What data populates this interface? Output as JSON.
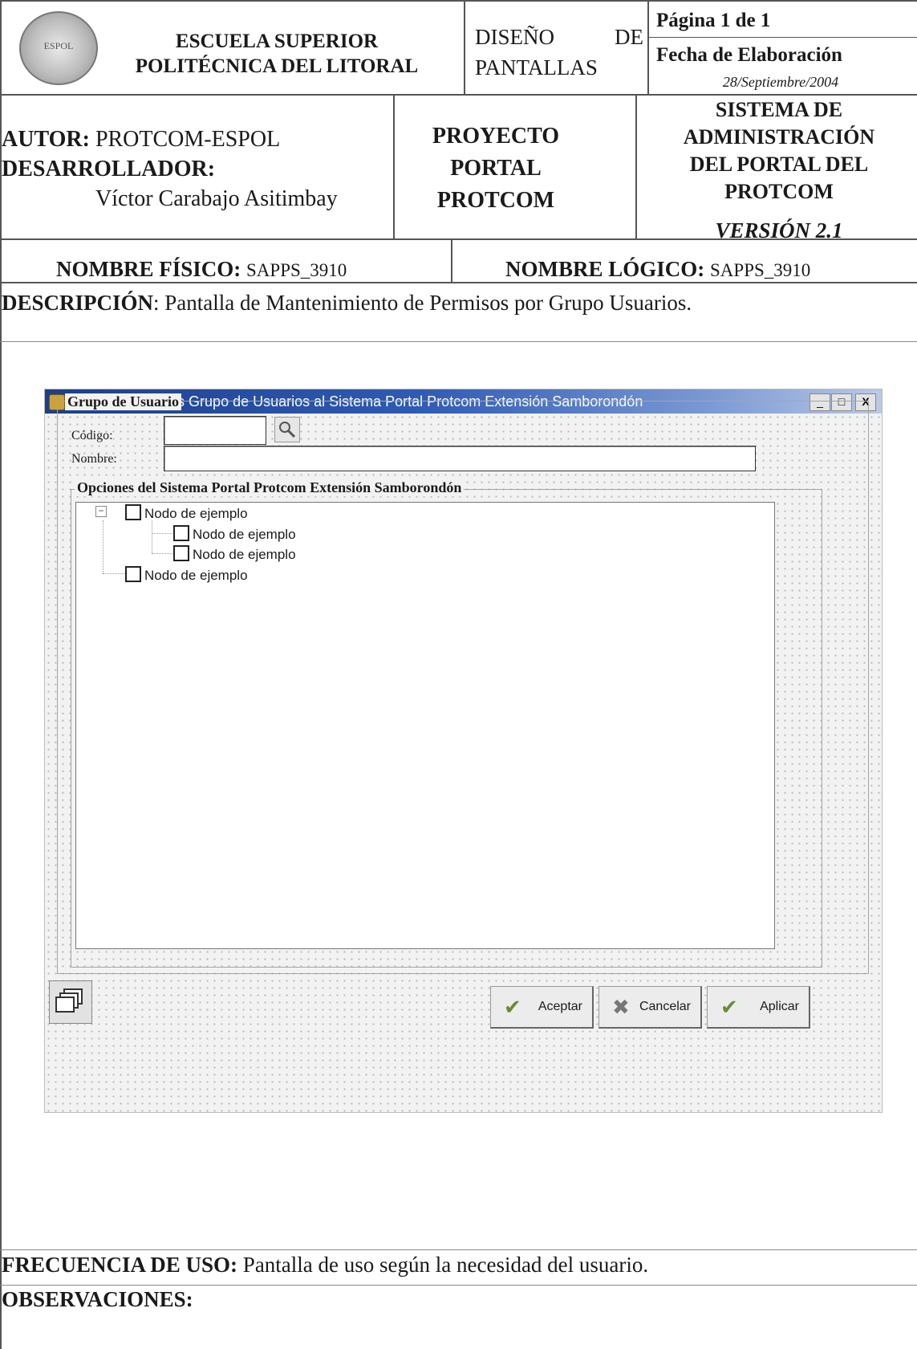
{
  "header": {
    "institution": [
      "ESCUELA SUPERIOR",
      "POLITÉCNICA DEL LITORAL"
    ],
    "doc_type": [
      "DISEÑO",
      "DE",
      "PANTALLAS"
    ],
    "page": "Página 1 de 1",
    "date_label": "Fecha de Elaboración",
    "date_value": "28/Septiembre/2004",
    "author_label": "AUTOR:",
    "author_value": "PROTCOM-ESPOL",
    "developer_label": "DESARROLLADOR:",
    "developer_value": "Víctor Carabajo Asitimbay",
    "project": [
      "PROYECTO",
      "PORTAL",
      "PROTCOM"
    ],
    "system": [
      "SISTEMA DE",
      "ADMINISTRACIÓN",
      "DEL PORTAL DEL",
      "PROTCOM"
    ],
    "version": "VERSIÓN 2.1",
    "logo_text": "ESPOL"
  },
  "names": {
    "physical_label": "NOMBRE FÍSICO:",
    "physical_value": "SAPPS_3910",
    "logical_label": "NOMBRE LÓGICO:",
    "logical_value": "SAPPS_3910"
  },
  "description": {
    "label": "DESCRIPCIÓN",
    "value": ": Pantalla de Mantenimiento de Permisos por Grupo Usuarios."
  },
  "window": {
    "title": "Permisos para los Grupo de Usuarios al Sistema Portal Protcom Extensión Samborondón",
    "group_label": "Grupo de Usuario",
    "code_label": "Código:",
    "code_value": "",
    "name_label": "Nombre:",
    "name_value": "",
    "options_label": "Opciones del Sistema Portal Protcom Extensión Samborondón",
    "tree_nodes": [
      "Nodo de ejemplo",
      "Nodo de ejemplo",
      "Nodo de ejemplo",
      "Nodo de ejemplo"
    ],
    "buttons": {
      "accept": "Aceptar",
      "cancel": "Cancelar",
      "apply": "Aplicar"
    },
    "controls": {
      "minimize": "_",
      "maximize": "□",
      "close": "X",
      "expand": "−"
    }
  },
  "footer": {
    "frequency_label": "FRECUENCIA DE USO:",
    "frequency_value": "Pantalla de uso según la necesidad del usuario.",
    "observations_label": "OBSERVACIONES:"
  }
}
